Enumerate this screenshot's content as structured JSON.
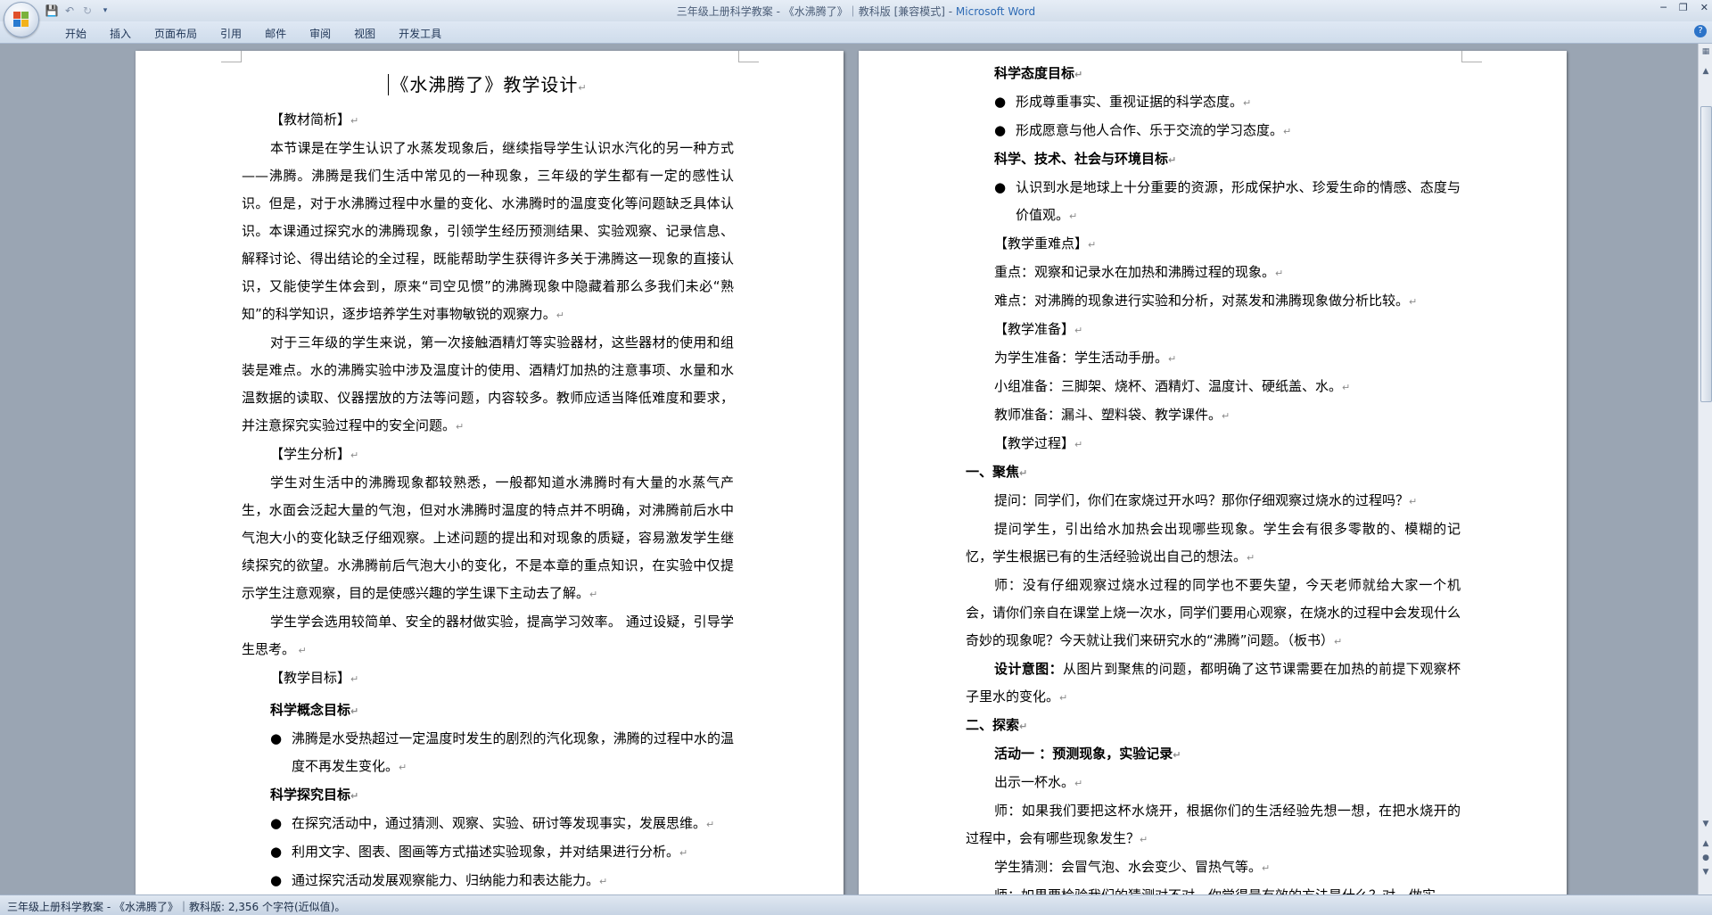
{
  "window": {
    "title": "三年级上册科学教案 - 《水沸腾了》｜教科版 [兼容模式] - ",
    "app_name": "Microsoft Word"
  },
  "ribbon": {
    "tabs": [
      "开始",
      "插入",
      "页面布局",
      "引用",
      "邮件",
      "审阅",
      "视图",
      "开发工具"
    ]
  },
  "page1": {
    "title": "《水沸腾了》教学设计",
    "h_textbook": "【教材简析】",
    "p1": "本节课是在学生认识了水蒸发现象后，继续指导学生认识水汽化的另一种方式——沸腾。沸腾是我们生活中常见的一种现象，三年级的学生都有一定的感性认识。但是，对于水沸腾过程中水量的变化、水沸腾时的温度变化等问题缺乏具体认识。本课通过探究水的沸腾现象，引领学生经历预测结果、实验观察、记录信息、解释讨论、得出结论的全过程，既能帮助学生获得许多关于沸腾这一现象的直接认识，又能使学生体会到，原来“司空见惯”的沸腾现象中隐藏着那么多我们未必“熟知”的科学知识，逐步培养学生对事物敏锐的观察力。",
    "p2": "对于三年级的学生来说，第一次接触酒精灯等实验器材，这些器材的使用和组装是难点。水的沸腾实验中涉及温度计的使用、酒精灯加热的注意事项、水量和水温数据的读取、仪器摆放的方法等问题，内容较多。教师应适当降低难度和要求，并注意探究实验过程中的安全问题。",
    "h_students": "【学生分析】",
    "p3": "学生对生活中的沸腾现象都较熟悉，一般都知道水沸腾时有大量的水蒸气产生，水面会泛起大量的气泡，但对水沸腾时温度的特点并不明确，对沸腾前后水中气泡大小的变化缺乏仔细观察。上述问题的提出和对现象的质疑，容易激发学生继续探究的欲望。水沸腾前后气泡大小的变化，不是本章的重点知识，在实验中仅提示学生注意观察，目的是使感兴趣的学生课下主动去了解。",
    "p4": "学生学会选用较简单、安全的器材做实验，提高学习效率。 通过设疑，引导学生思考。",
    "h_goals": "【教学目标】",
    "h_concept": "科学概念目标",
    "b1": "沸腾是水受热超过一定温度时发生的剧烈的汽化现象，沸腾的过程中水的温度不再发生变化。",
    "h_inquiry": "科学探究目标",
    "b2": "在探究活动中，通过猜测、观察、实验、研讨等发现事实，发展思维。",
    "b3": "利用文字、图表、图画等方式描述实验现象，并对结果进行分析。",
    "b4": "通过探究活动发展观察能力、归纳能力和表达能力。"
  },
  "page2": {
    "h_attitude": "科学态度目标",
    "b1": "形成尊重事实、重视证据的科学态度。",
    "b2": "形成愿意与他人合作、乐于交流的学习态度。",
    "h_sts": "科学、技术、社会与环境目标",
    "b3": "认识到水是地球上十分重要的资源，形成保护水、珍爱生命的情感、态度与价值观。",
    "h_keypoints": "【教学重难点】",
    "key": "重点：观察和记录水在加热和沸腾过程的现象。",
    "difficult": "难点：对沸腾的现象进行实验和分析，对蒸发和沸腾现象做分析比较。",
    "h_prep": "【教学准备】",
    "prep_students": "为学生准备：学生活动手册。",
    "prep_groups": "小组准备：三脚架、烧杯、酒精灯、温度计、硬纸盖、水。",
    "prep_teacher": "教师准备：漏斗、塑料袋、教学课件。",
    "h_process": "【教学过程】",
    "h_focus": "一、聚焦",
    "q1": "提问：同学们，你们在家烧过开水吗？那你仔细观察过烧水的过程吗？",
    "q2": "提问学生，引出给水加热会出现哪些现象。学生会有很多零散的、模糊的记忆，学生根据已有的生活经验说出自己的想法。",
    "q3": "师：没有仔细观察过烧水过程的同学也不要失望，今天老师就给大家一个机会，请你们亲自在课堂上烧一次水，同学们要用心观察，在烧水的过程中会发现什么奇妙的现象呢？今天就让我们来研究水的“沸腾”问题。（板书）",
    "design_label": "设计意图：",
    "design_text": "从图片到聚焦的问题，都明确了这节课需要在加热的前提下观察杯子里水的变化。",
    "h_explore": "二、探索",
    "activity1": "活动一 ：预测现象，实验记录",
    "show": "出示一杯水。",
    "q4": "师：如果我们要把这杯水烧开，根据你们的生活经验先想一想，在把水烧开的过程中，会有哪些现象发生？",
    "guess": "学生猜测：会冒气泡、水会变少、冒热气等。",
    "q5": "师：如果要检验我们的猜测对不对，你觉得最有效的方法是什么？对，做实"
  },
  "status": {
    "text": "三年级上册科学教案 - 《水沸腾了》｜教科版: 2,356 个字符(近似值)。"
  }
}
